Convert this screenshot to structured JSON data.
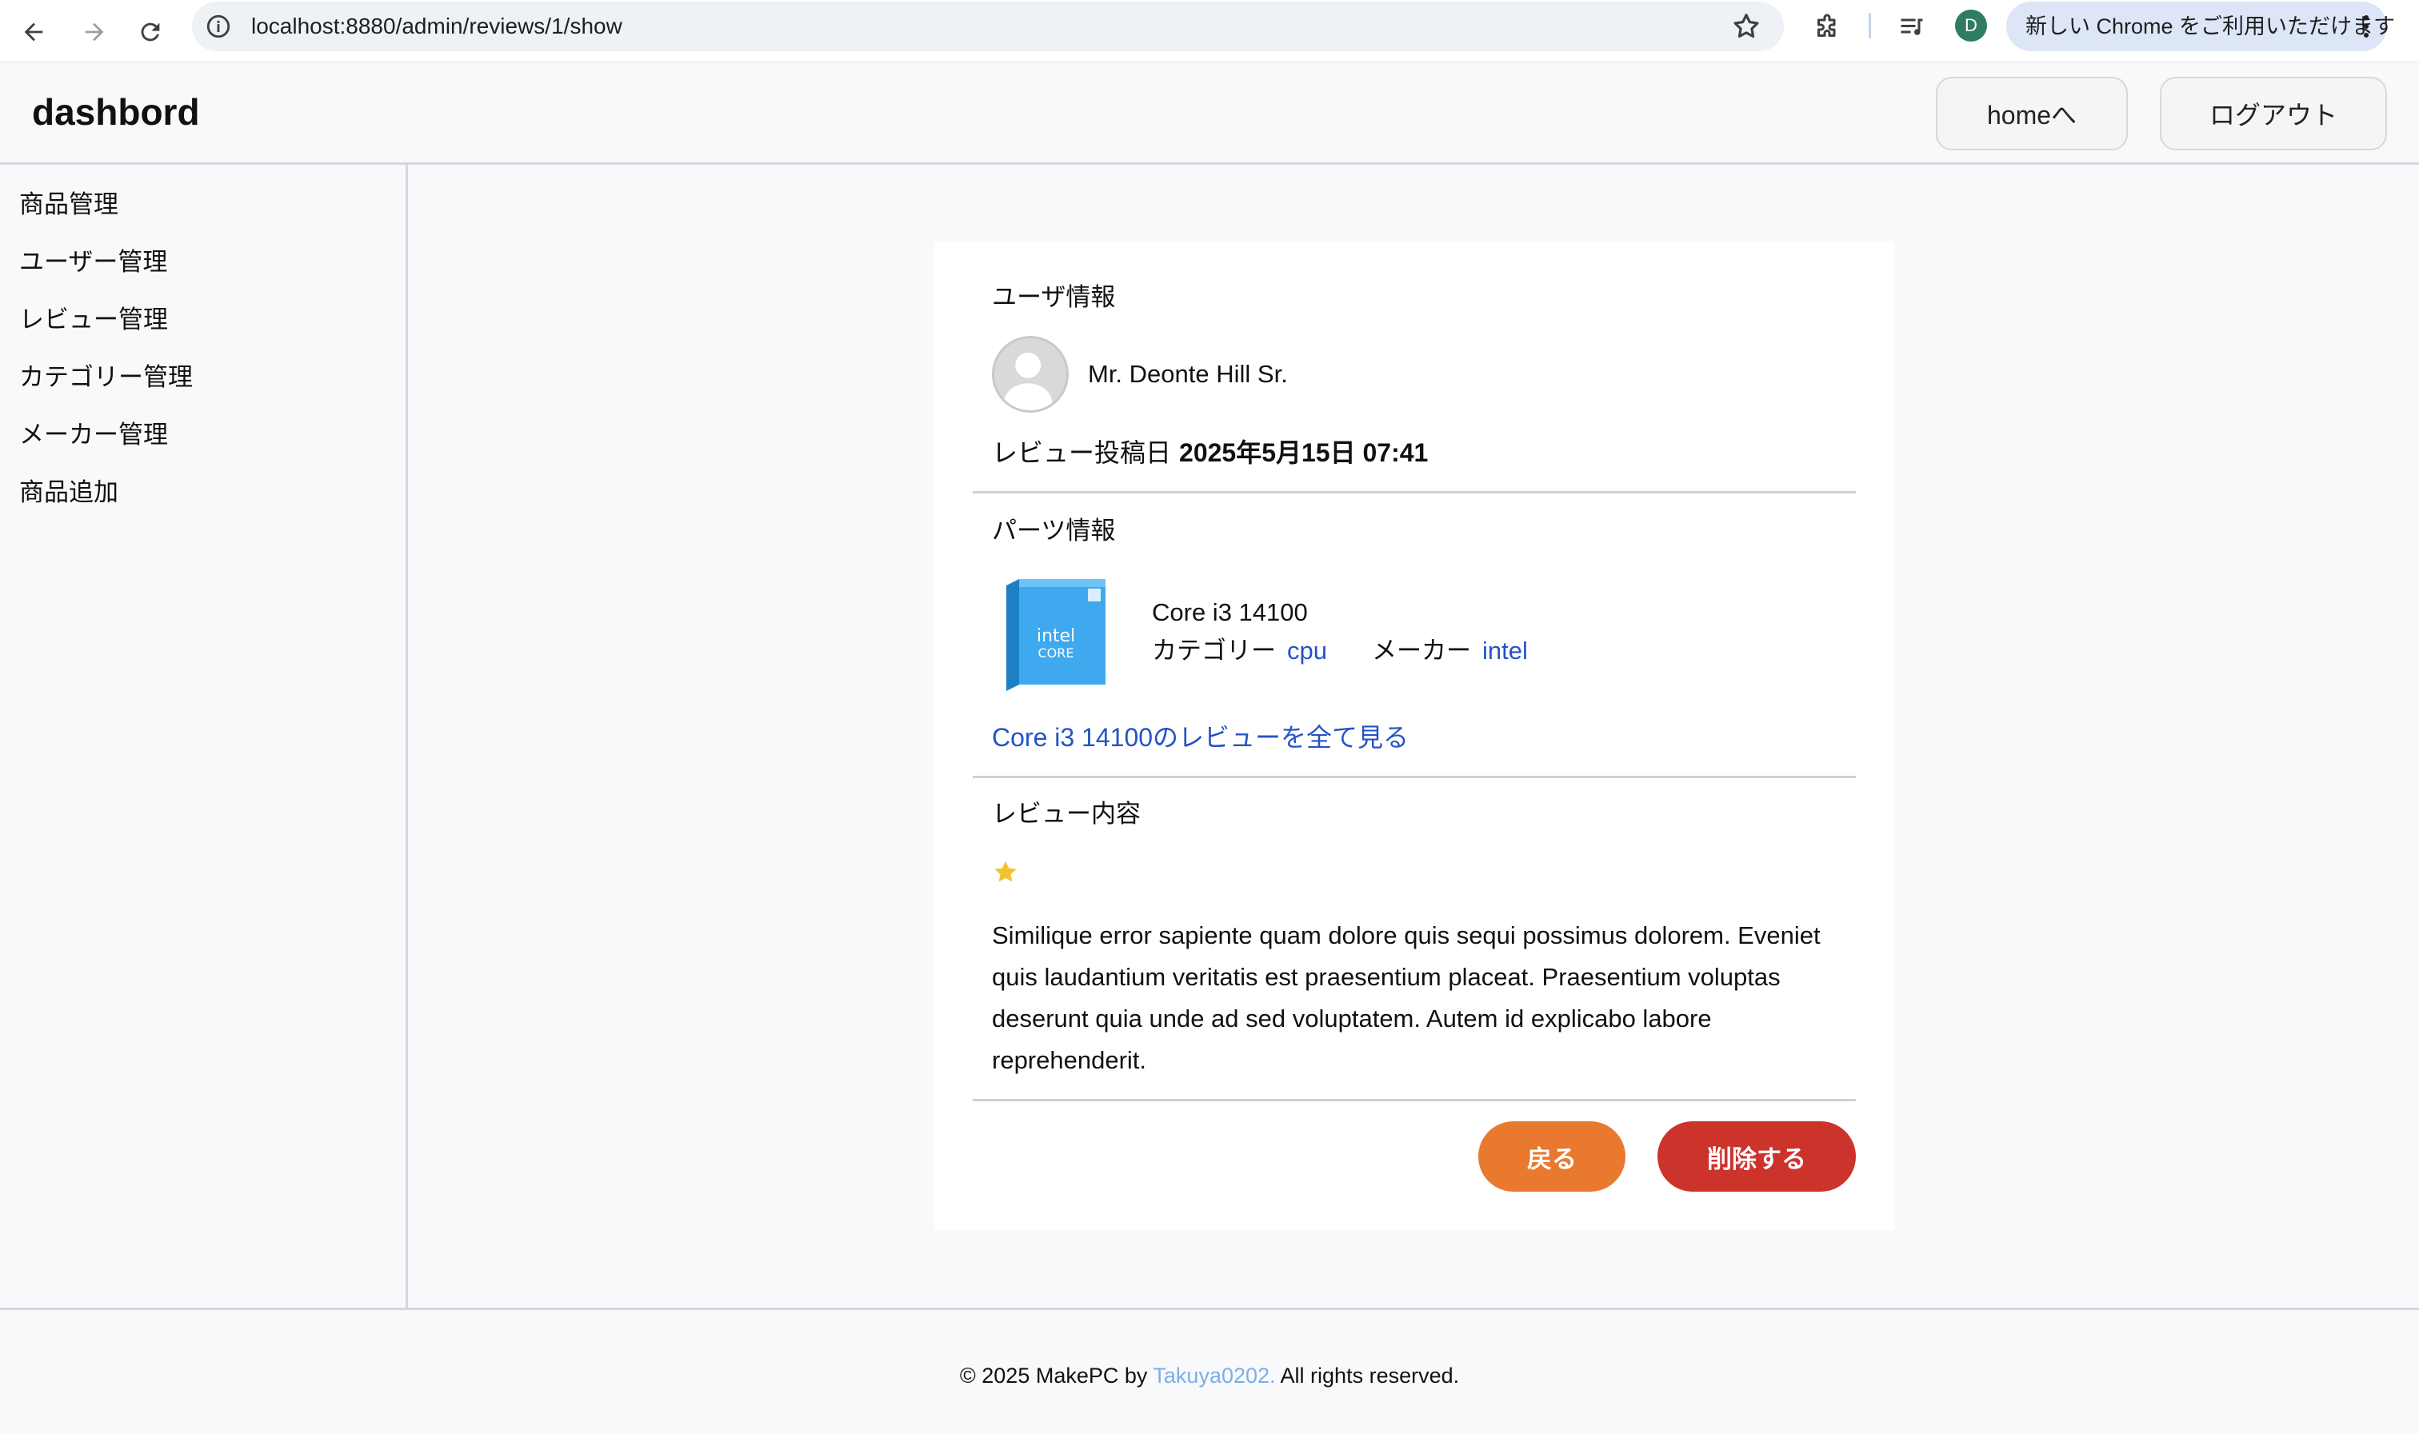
{
  "browser": {
    "url": "localhost:8880/admin/reviews/1/show",
    "profile_initial": "D",
    "promo_text": "新しい Chrome をご利用いただけます"
  },
  "header": {
    "brand": "dashbord",
    "home_label": "homeへ",
    "logout_label": "ログアウト"
  },
  "sidebar": {
    "items": [
      {
        "label": "商品管理"
      },
      {
        "label": "ユーザー管理"
      },
      {
        "label": "レビュー管理"
      },
      {
        "label": "カテゴリー管理"
      },
      {
        "label": "メーカー管理"
      },
      {
        "label": "商品追加"
      }
    ]
  },
  "user_section": {
    "title": "ユーザ情報",
    "user_name": "Mr. Deonte Hill Sr.",
    "posted_label": "レビュー投稿日",
    "posted_value": "2025年5月15日 07:41"
  },
  "parts_section": {
    "title": "パーツ情報",
    "product_name": "Core i3 14100",
    "category_label": "カテゴリー",
    "category_value": "cpu",
    "maker_label": "メーカー",
    "maker_value": "intel",
    "all_reviews_link": "Core i3 14100のレビューを全て見る"
  },
  "review_section": {
    "title": "レビュー内容",
    "rating": 1,
    "body": "Similique error sapiente quam dolore quis sequi possimus dolorem. Eveniet quis laudantium veritatis est praesentium placeat. Praesentium voluptas deserunt quia unde ad sed voluptatem. Autem id explicabo labore reprehenderit."
  },
  "actions": {
    "back_label": "戻る",
    "delete_label": "削除する"
  },
  "footer": {
    "prefix": "© 2025 MakePC by ",
    "author": "Takuya0202.",
    "suffix": " All rights reserved."
  },
  "colors": {
    "back_button": "#e8792f",
    "delete_button": "#cc332b",
    "link": "#2453c6",
    "star": "#f2c230"
  }
}
